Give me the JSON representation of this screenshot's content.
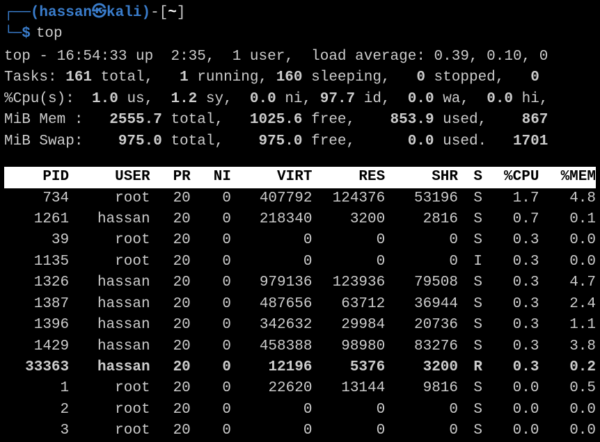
{
  "prompt": {
    "user": "hassan",
    "host": "kali",
    "path": "~",
    "symbol": "$",
    "command": "top"
  },
  "summary": {
    "line1_pre": "top - ",
    "time": "16:54:33",
    "up": " up  2:35,  ",
    "users": "1 user,",
    "load_label": "  load average: ",
    "load_vals": "0.39, 0.10, 0",
    "tasks_label": "Tasks: ",
    "tasks_total": "161",
    "tasks_total_lbl": " total,   ",
    "tasks_running": "1",
    "tasks_running_lbl": " running, ",
    "tasks_sleeping": "160",
    "tasks_sleeping_lbl": " sleeping,   ",
    "tasks_stopped": "0",
    "tasks_stopped_lbl": " stopped,   ",
    "tasks_zombie": "0",
    "cpu_label": "%Cpu(s):  ",
    "cpu_us": "1.0",
    "cpu_us_lbl": " us,  ",
    "cpu_sy": "1.2",
    "cpu_sy_lbl": " sy,  ",
    "cpu_ni": "0.0",
    "cpu_ni_lbl": " ni, ",
    "cpu_id": "97.7",
    "cpu_id_lbl": " id,  ",
    "cpu_wa": "0.0",
    "cpu_wa_lbl": " wa,  ",
    "cpu_hi": "0.0",
    "cpu_hi_lbl": " hi,",
    "mem_label": "MiB Mem :   ",
    "mem_total": "2555.7",
    "mem_total_lbl": " total,   ",
    "mem_free": "1025.6",
    "mem_free_lbl": " free,    ",
    "mem_used": "853.9",
    "mem_used_lbl": " used,    ",
    "mem_buff": "867",
    "swap_label": "MiB Swap:    ",
    "swap_total": "975.0",
    "swap_total_lbl": " total,    ",
    "swap_free": "975.0",
    "swap_free_lbl": " free,      ",
    "swap_used": "0.0",
    "swap_used_lbl": " used.   ",
    "swap_avail": "1701"
  },
  "headers": {
    "pid": "PID",
    "user": "USER",
    "pr": "PR",
    "ni": "NI",
    "virt": "VIRT",
    "res": "RES",
    "shr": "SHR",
    "s": "S",
    "cpu": "%CPU",
    "mem": "%MEM"
  },
  "rows": [
    {
      "pid": "734",
      "user": "root",
      "pr": "20",
      "ni": "0",
      "virt": "407792",
      "res": "124376",
      "shr": "53196",
      "s": "S",
      "cpu": "1.7",
      "mem": "4.8",
      "bold": false
    },
    {
      "pid": "1261",
      "user": "hassan",
      "pr": "20",
      "ni": "0",
      "virt": "218340",
      "res": "3200",
      "shr": "2816",
      "s": "S",
      "cpu": "0.7",
      "mem": "0.1",
      "bold": false
    },
    {
      "pid": "39",
      "user": "root",
      "pr": "20",
      "ni": "0",
      "virt": "0",
      "res": "0",
      "shr": "0",
      "s": "S",
      "cpu": "0.3",
      "mem": "0.0",
      "bold": false
    },
    {
      "pid": "1135",
      "user": "root",
      "pr": "20",
      "ni": "0",
      "virt": "0",
      "res": "0",
      "shr": "0",
      "s": "I",
      "cpu": "0.3",
      "mem": "0.0",
      "bold": false
    },
    {
      "pid": "1326",
      "user": "hassan",
      "pr": "20",
      "ni": "0",
      "virt": "979136",
      "res": "123936",
      "shr": "79508",
      "s": "S",
      "cpu": "0.3",
      "mem": "4.7",
      "bold": false
    },
    {
      "pid": "1387",
      "user": "hassan",
      "pr": "20",
      "ni": "0",
      "virt": "487656",
      "res": "63712",
      "shr": "36944",
      "s": "S",
      "cpu": "0.3",
      "mem": "2.4",
      "bold": false
    },
    {
      "pid": "1396",
      "user": "hassan",
      "pr": "20",
      "ni": "0",
      "virt": "342632",
      "res": "29984",
      "shr": "20736",
      "s": "S",
      "cpu": "0.3",
      "mem": "1.1",
      "bold": false
    },
    {
      "pid": "1429",
      "user": "hassan",
      "pr": "20",
      "ni": "0",
      "virt": "458388",
      "res": "98980",
      "shr": "83276",
      "s": "S",
      "cpu": "0.3",
      "mem": "3.8",
      "bold": false
    },
    {
      "pid": "33363",
      "user": "hassan",
      "pr": "20",
      "ni": "0",
      "virt": "12196",
      "res": "5376",
      "shr": "3200",
      "s": "R",
      "cpu": "0.3",
      "mem": "0.2",
      "bold": true
    },
    {
      "pid": "1",
      "user": "root",
      "pr": "20",
      "ni": "0",
      "virt": "22620",
      "res": "13144",
      "shr": "9816",
      "s": "S",
      "cpu": "0.0",
      "mem": "0.5",
      "bold": false
    },
    {
      "pid": "2",
      "user": "root",
      "pr": "20",
      "ni": "0",
      "virt": "0",
      "res": "0",
      "shr": "0",
      "s": "S",
      "cpu": "0.0",
      "mem": "0.0",
      "bold": false
    },
    {
      "pid": "3",
      "user": "root",
      "pr": "20",
      "ni": "0",
      "virt": "0",
      "res": "0",
      "shr": "0",
      "s": "S",
      "cpu": "0.0",
      "mem": "0.0",
      "bold": false
    }
  ]
}
